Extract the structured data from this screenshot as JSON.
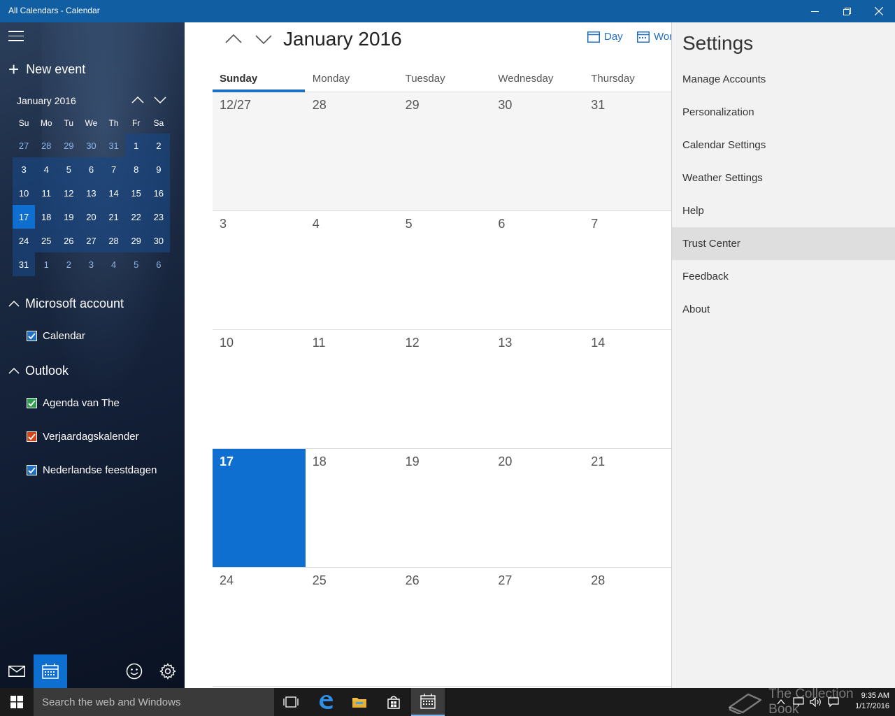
{
  "window": {
    "title": "All Calendars - Calendar",
    "accent": "#115ea3"
  },
  "sidebar": {
    "new_event": "New event",
    "mini": {
      "title": "January 2016",
      "day_headers": [
        "Su",
        "Mo",
        "Tu",
        "We",
        "Th",
        "Fr",
        "Sa"
      ],
      "weeks": [
        [
          "27",
          "28",
          "29",
          "30",
          "31",
          "1",
          "2"
        ],
        [
          "3",
          "4",
          "5",
          "6",
          "7",
          "8",
          "9"
        ],
        [
          "10",
          "11",
          "12",
          "13",
          "14",
          "15",
          "16"
        ],
        [
          "17",
          "18",
          "19",
          "20",
          "21",
          "22",
          "23"
        ],
        [
          "24",
          "25",
          "26",
          "27",
          "28",
          "29",
          "30"
        ],
        [
          "31",
          "1",
          "2",
          "3",
          "4",
          "5",
          "6"
        ]
      ],
      "today": "17"
    },
    "accounts": [
      {
        "name": "Microsoft account",
        "calendars": [
          {
            "name": "Calendar",
            "color": "#1f6fc5"
          }
        ]
      },
      {
        "name": "Outlook",
        "calendars": [
          {
            "name": "Agenda van The",
            "color": "#2e9e4f"
          },
          {
            "name": "Verjaardagskalender",
            "color": "#d84315"
          },
          {
            "name": "Nederlandse feestdagen",
            "color": "#1f6fc5"
          }
        ]
      }
    ]
  },
  "main": {
    "month_title": "January 2016",
    "view_day": "Day",
    "view_work_week": "Wor",
    "day_headers": [
      "Sunday",
      "Monday",
      "Tuesday",
      "Wednesday",
      "Thursday"
    ],
    "weeks": [
      [
        "12/27",
        "28",
        "29",
        "30",
        "31"
      ],
      [
        "3",
        "4",
        "5",
        "6",
        "7"
      ],
      [
        "10",
        "11",
        "12",
        "13",
        "14"
      ],
      [
        "17",
        "18",
        "19",
        "20",
        "21"
      ],
      [
        "24",
        "25",
        "26",
        "27",
        "28"
      ]
    ],
    "today": "17"
  },
  "settings": {
    "title": "Settings",
    "items": [
      "Manage Accounts",
      "Personalization",
      "Calendar Settings",
      "Weather Settings",
      "Help",
      "Trust Center",
      "Feedback",
      "About"
    ],
    "hovered": "Trust Center"
  },
  "taskbar": {
    "search_placeholder": "Search the web and Windows",
    "time": "9:35 AM",
    "date": "1/17/2016",
    "watermark": "The Collection Book"
  }
}
